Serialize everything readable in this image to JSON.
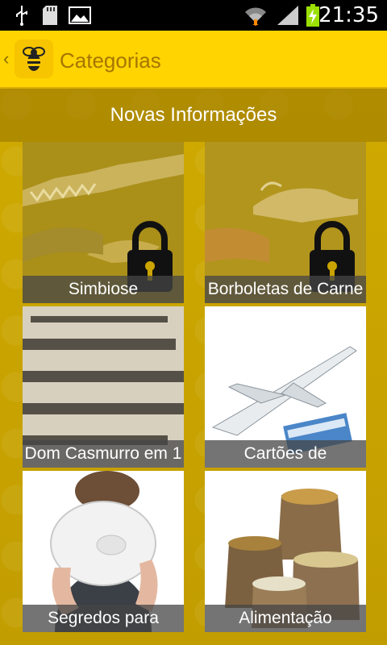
{
  "status_bar": {
    "time": "21:35",
    "icons": [
      "usb-icon",
      "sd-card-icon",
      "image-icon",
      "wifi-icon",
      "signal-icon",
      "battery-charging-icon"
    ]
  },
  "action_bar": {
    "title": "Categorias",
    "app_icon": "bee-icon",
    "back_icon": "chevron-left-icon"
  },
  "section": {
    "header": "Novas Informações"
  },
  "categories": [
    {
      "label": "Simbiose",
      "locked": true
    },
    {
      "label": "Borboletas de Carne",
      "locked": true
    },
    {
      "label": "Dom Casmurro em 1",
      "locked": false
    },
    {
      "label": "Cartões de",
      "locked": false
    },
    {
      "label": "Segredos para",
      "locked": false
    },
    {
      "label": "Alimentação",
      "locked": false
    }
  ],
  "colors": {
    "action_bar": "#ffd400",
    "title_text": "#a67600",
    "background": "#c7a300"
  }
}
